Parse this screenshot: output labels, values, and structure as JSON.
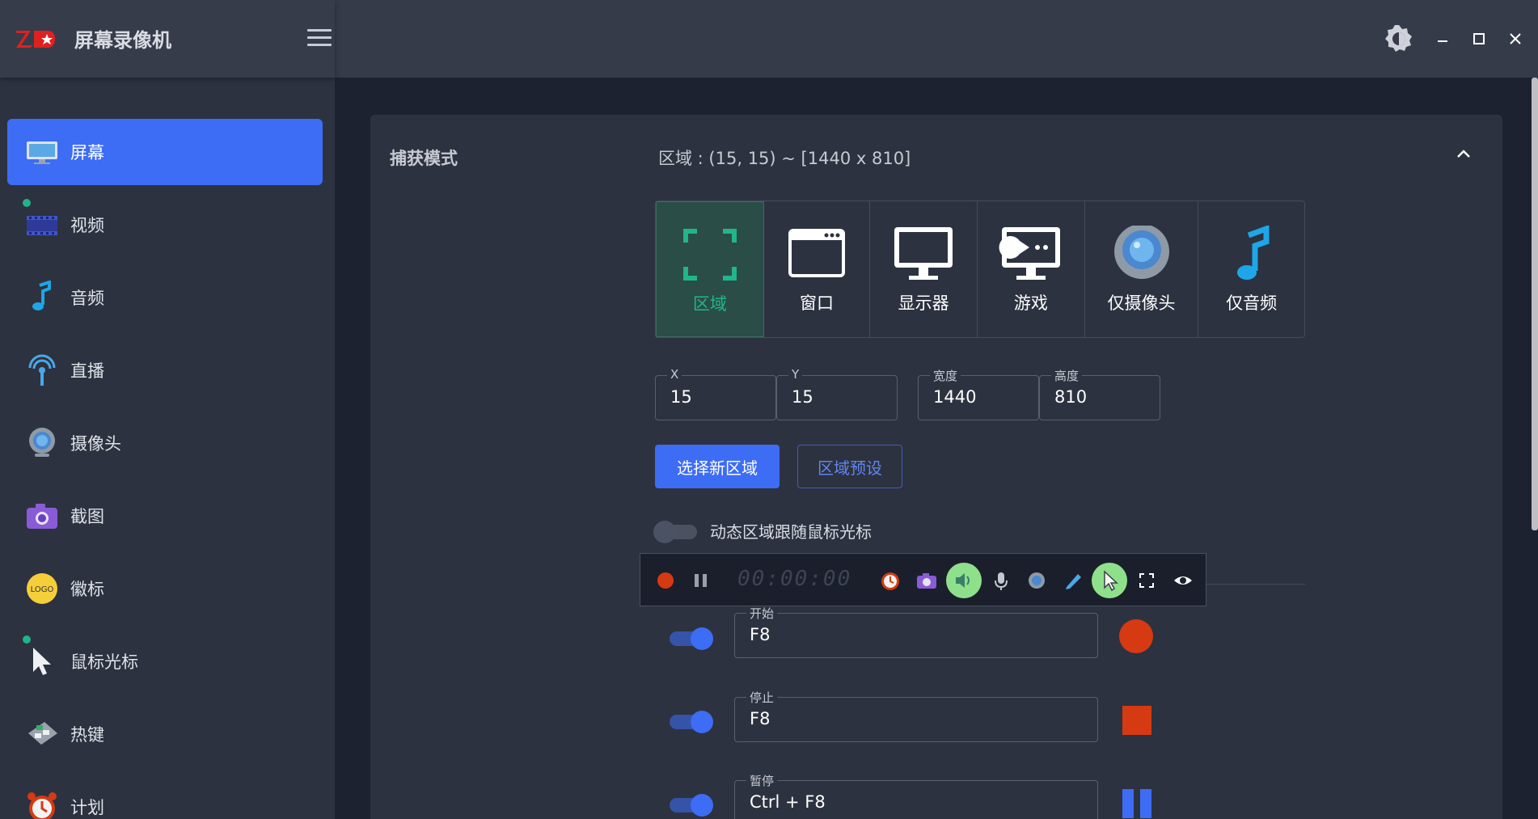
{
  "app": {
    "title": "屏幕录像机",
    "logo_text": "Z"
  },
  "sidebar": {
    "items": [
      {
        "label": "屏幕",
        "icon": "monitor-icon"
      },
      {
        "label": "视频",
        "icon": "film-icon"
      },
      {
        "label": "音频",
        "icon": "music-note-icon"
      },
      {
        "label": "直播",
        "icon": "broadcast-icon"
      },
      {
        "label": "摄像头",
        "icon": "webcam-icon"
      },
      {
        "label": "截图",
        "icon": "camera-icon"
      },
      {
        "label": "徽标",
        "icon": "logo-badge-icon",
        "badge_text": "LOGO"
      },
      {
        "label": "鼠标光标",
        "icon": "cursor-icon"
      },
      {
        "label": "热键",
        "icon": "keyboard-icon"
      },
      {
        "label": "计划",
        "icon": "alarm-clock-icon"
      }
    ]
  },
  "capture": {
    "section_title": "捕获模式",
    "region_summary": "区域 : (15, 15) ~ [1440 x 810]",
    "modes": [
      {
        "label": "区域",
        "icon": "region-select-icon"
      },
      {
        "label": "窗口",
        "icon": "window-icon"
      },
      {
        "label": "显示器",
        "icon": "monitor-icon"
      },
      {
        "label": "游戏",
        "icon": "game-icon"
      },
      {
        "label": "仅摄像头",
        "icon": "webcam-icon"
      },
      {
        "label": "仅音频",
        "icon": "music-note-icon"
      }
    ],
    "fields": {
      "x": {
        "label": "X",
        "value": "15"
      },
      "y": {
        "label": "Y",
        "value": "15"
      },
      "width": {
        "label": "宽度",
        "value": "1440"
      },
      "height": {
        "label": "高度",
        "value": "810"
      }
    },
    "select_region_label": "选择新区域",
    "region_preset_label": "区域预设",
    "dynamic_follow_label": "动态区域跟随鼠标光标"
  },
  "toolbar": {
    "timer": "00:00:00"
  },
  "hotkeys": {
    "start": {
      "label": "开始",
      "value": "F8"
    },
    "stop": {
      "label": "停止",
      "value": "F8"
    },
    "pause": {
      "label": "暂停",
      "value": "Ctrl + F8"
    }
  },
  "colors": {
    "accent": "#3d6cf5",
    "active_mode": "#21b58c",
    "record_red": "#d63a12",
    "toggle_on": "#8fe08a"
  }
}
